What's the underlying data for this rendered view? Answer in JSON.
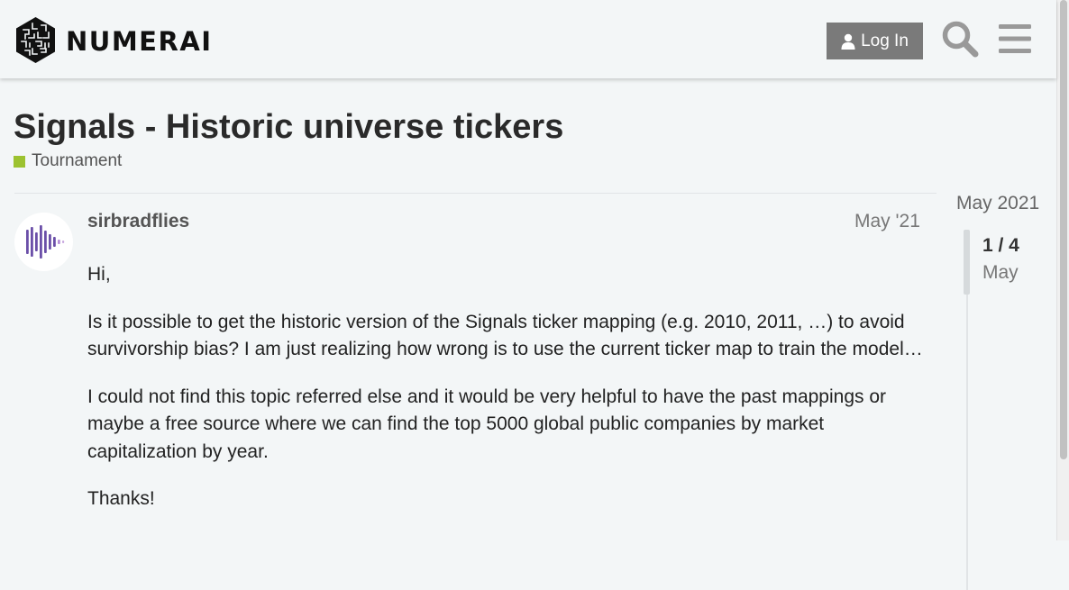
{
  "header": {
    "brand": "NUMERAI",
    "login_label": "Log In",
    "icons": [
      "numerai-logo-icon",
      "user-icon",
      "search-icon",
      "hamburger-menu-icon"
    ]
  },
  "topic": {
    "title": "Signals - Historic universe tickers",
    "category": "Tournament",
    "category_color": "#9cc230"
  },
  "post": {
    "username": "sirbradflies",
    "date": "May '21",
    "paragraphs": [
      "Hi,",
      "Is it possible to get the historic version of the Signals ticker mapping (e.g. 2010, 2011, …) to avoid survivorship bias? I am just realizing how wrong is to use the current ticker map to train the model…",
      "I could not find this topic referred else and it would be very helpful to have the past mappings or maybe a free source where we can find the top 5000 global public companies by market capitalization by year.",
      "Thanks!"
    ]
  },
  "timeline": {
    "start_date": "May 2021",
    "count": "1 / 4",
    "current_date": "May"
  },
  "colors": {
    "background": "#f3f6f7",
    "button": "#7a7a7a",
    "avatar_bars": "#6b4fa8"
  }
}
